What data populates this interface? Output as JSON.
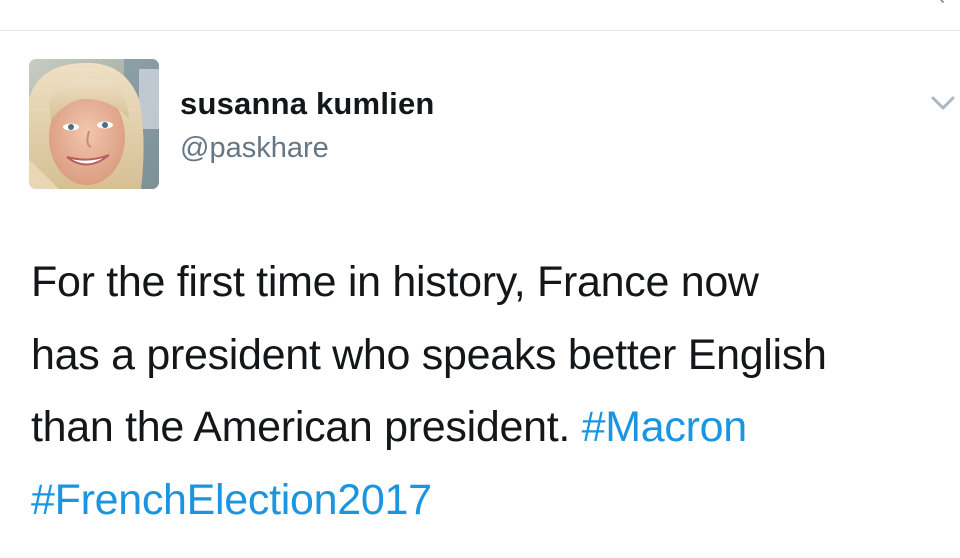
{
  "colors": {
    "text": "#14171a",
    "secondary": "#657786",
    "link": "#1b95e0",
    "divider": "#e1e8ed"
  },
  "tweet": {
    "author": {
      "display_name": "susanna kumlien",
      "handle": "@paskhare",
      "avatar_icon": "profile-photo"
    },
    "menu_icon": "chevron-down-icon",
    "text": {
      "line1": "For the first time in history, France now",
      "line2": "has a president who speaks better English",
      "line3_plain": "than the American president. ",
      "hashtag1": "#Macron",
      "hashtag2": "#FrenchElection2017"
    }
  }
}
